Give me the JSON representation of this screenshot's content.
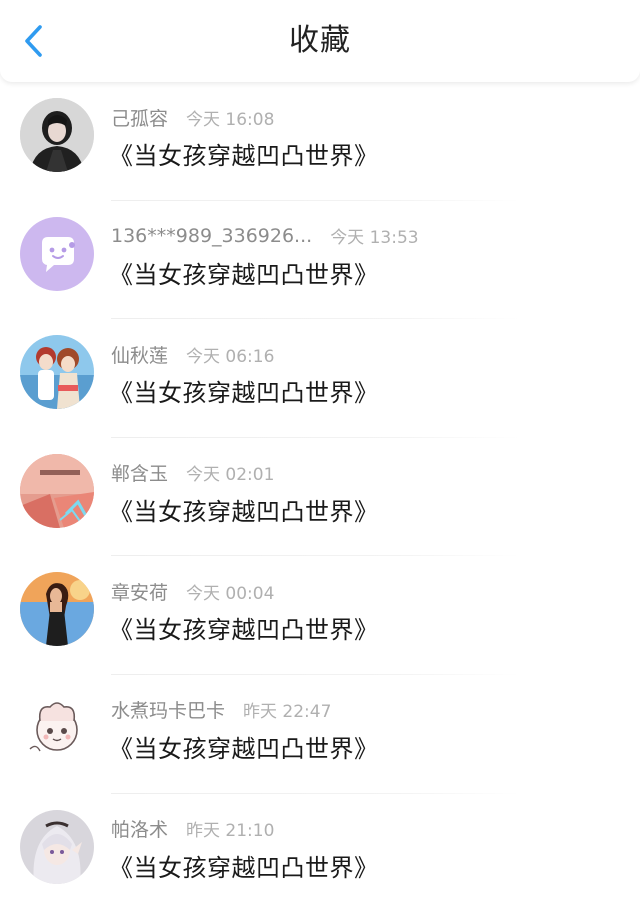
{
  "header": {
    "title": "收藏",
    "back_icon": "chevron-left-icon",
    "accent_color": "#2f9bf0"
  },
  "items": [
    {
      "username": "己孤容",
      "time": "今天 16:08",
      "content": "《当女孩穿越凹凸世界》"
    },
    {
      "username": "136***989_336926...",
      "time": "今天 13:53",
      "content": "《当女孩穿越凹凸世界》"
    },
    {
      "username": "仙秋莲",
      "time": "今天 06:16",
      "content": "《当女孩穿越凹凸世界》"
    },
    {
      "username": "郸含玉",
      "time": "今天 02:01",
      "content": "《当女孩穿越凹凸世界》"
    },
    {
      "username": "章安荷",
      "time": "今天 00:04",
      "content": "《当女孩穿越凹凸世界》"
    },
    {
      "username": "水煮玛卡巴卡",
      "time": "昨天 22:47",
      "content": "《当女孩穿越凹凸世界》"
    },
    {
      "username": "帕洛术",
      "time": "昨天 21:10",
      "content": "《当女孩穿越凹凸世界》"
    }
  ]
}
